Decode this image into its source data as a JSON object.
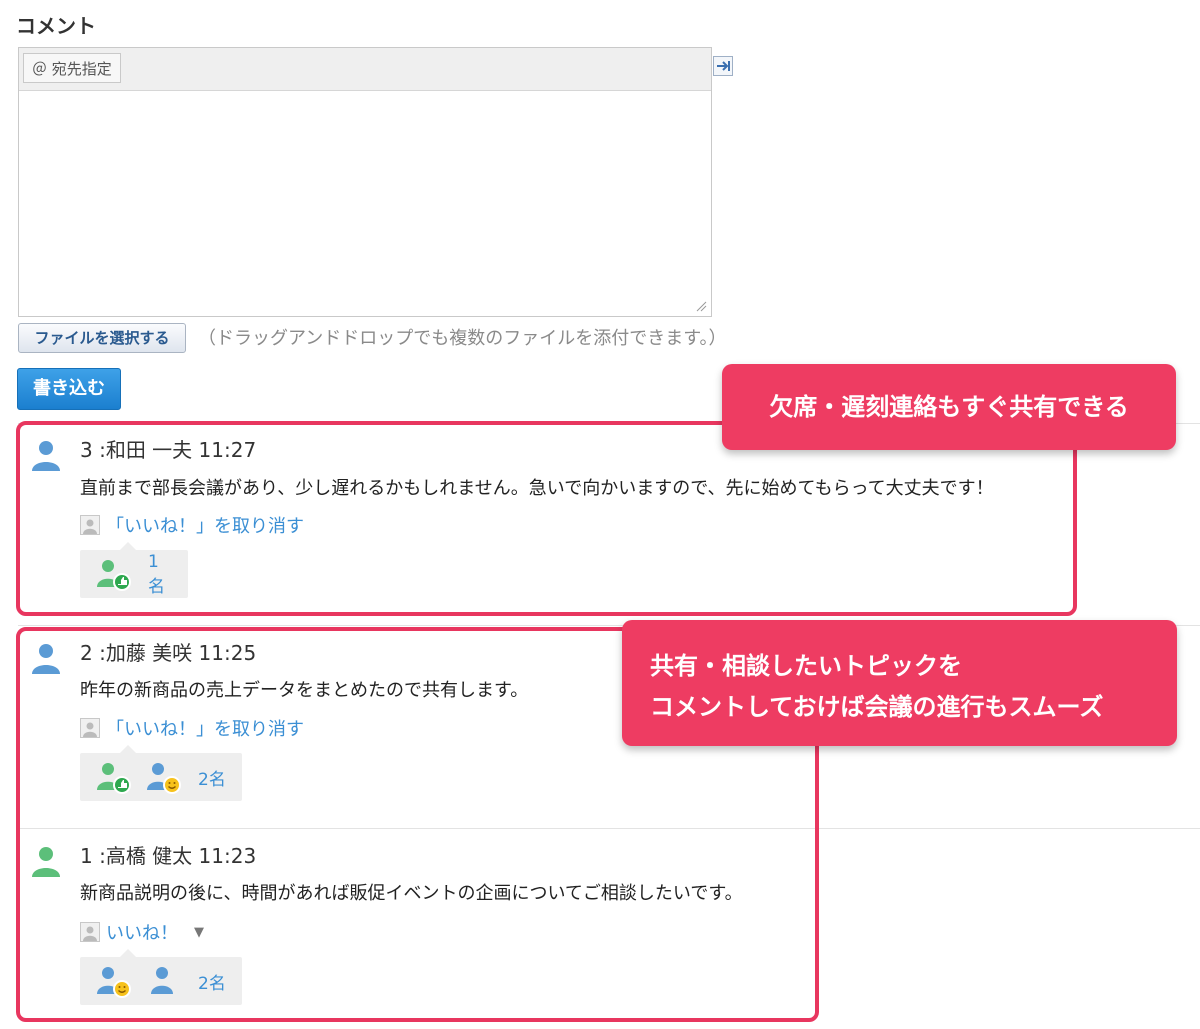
{
  "comment_form": {
    "title": "コメント",
    "mention_button": "＠ 宛先指定",
    "file_button": "ファイルを選択する",
    "file_hint": "（ドラッグアンドドロップでも複数のファイルを添付できます。）",
    "submit_button": "書き込む"
  },
  "comments": [
    {
      "header": "3 :和田 一夫  11:27",
      "body": "直前まで部長会議があり、少し遅れるかもしれません。急いで向かいますので、先に始めてもらって大丈夫です！",
      "like_action": "「いいね！」を取り消す",
      "like_count": "1名"
    },
    {
      "header": "2 :加藤 美咲  11:25",
      "body": "昨年の新商品の売上データをまとめたので共有します。",
      "like_action": "「いいね！」を取り消す",
      "like_count": "2名"
    },
    {
      "header": "1 :高橋 健太  11:23",
      "body": "新商品説明の後に、時間があれば販促イベントの企画についてご相談したいです。",
      "like_action": "いいね！",
      "like_count": "2名"
    }
  ],
  "callouts": {
    "first": "欠席・遅刻連絡もすぐ共有できる",
    "second_line1": "共有・相談したいトピックを",
    "second_line2": "コメントしておけば会議の進行もスムーズ"
  },
  "colors": {
    "accent_pink": "#ee3c62",
    "link_blue": "#3b8fd4",
    "avatar_blue": "#5b9bd5",
    "avatar_green": "#5cbf7a",
    "submit_blue": "#1b7fcf"
  }
}
